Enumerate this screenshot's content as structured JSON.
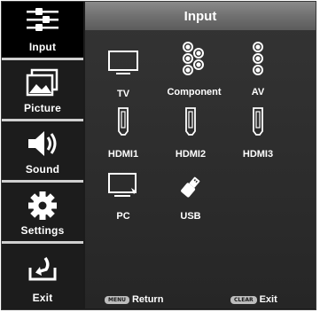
{
  "sidebar": {
    "items": [
      {
        "label": "Input",
        "icon": "input-cables-icon",
        "active": true
      },
      {
        "label": "Picture",
        "icon": "picture-icon",
        "active": false
      },
      {
        "label": "Sound",
        "icon": "speaker-icon",
        "active": false
      },
      {
        "label": "Settings",
        "icon": "gear-icon",
        "active": false
      },
      {
        "label": "Exit",
        "icon": "exit-arrow-icon",
        "active": false
      }
    ]
  },
  "main": {
    "title": "Input",
    "sources": [
      {
        "label": "TV",
        "icon": "tv-monitor-icon"
      },
      {
        "label": "Component",
        "icon": "component-jacks-icon"
      },
      {
        "label": "AV",
        "icon": "av-jacks-icon"
      },
      {
        "label": "HDMI1",
        "icon": "hdmi-port-icon"
      },
      {
        "label": "HDMI2",
        "icon": "hdmi-port-icon"
      },
      {
        "label": "HDMI3",
        "icon": "hdmi-port-icon"
      },
      {
        "label": "PC",
        "icon": "pc-monitor-icon"
      },
      {
        "label": "USB",
        "icon": "usb-icon"
      }
    ]
  },
  "footer": {
    "menu_key": "MENU",
    "return_label": "Return",
    "clear_key": "CLEAR",
    "exit_label": "Exit"
  },
  "colors": {
    "panel_bg": "#2c2c2c",
    "title_bar": "#707070",
    "active_sidebar": "#000000",
    "text": "#ffffff"
  }
}
